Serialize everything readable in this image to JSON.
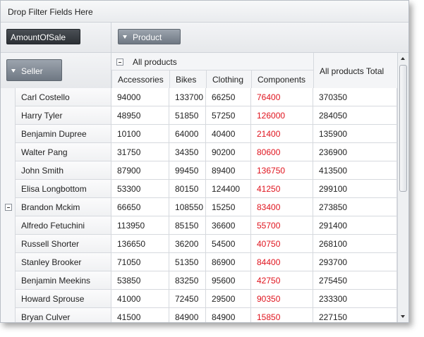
{
  "filter_bar": {
    "text": "Drop Filter Fields Here"
  },
  "data_fields": {
    "amount_chip": "AmountOfSale"
  },
  "column_fields": {
    "product_chip": "Product"
  },
  "row_fields": {
    "seller_chip": "Seller"
  },
  "column_header": {
    "group_label": "All products",
    "columns": [
      "Accessories",
      "Bikes",
      "Clothing",
      "Components"
    ],
    "total_label": "All products Total"
  },
  "rows": [
    {
      "seller": "Carl Costello",
      "accessories": "94000",
      "bikes": "133700",
      "clothing": "66250",
      "components": "76400",
      "total": "370350"
    },
    {
      "seller": "Harry Tyler",
      "accessories": "48950",
      "bikes": "51850",
      "clothing": "57250",
      "components": "126000",
      "total": "284050"
    },
    {
      "seller": "Benjamin Dupree",
      "accessories": "10100",
      "bikes": "64000",
      "clothing": "40400",
      "components": "21400",
      "total": "135900"
    },
    {
      "seller": "Walter Pang",
      "accessories": "31750",
      "bikes": "34350",
      "clothing": "90200",
      "components": "80600",
      "total": "236900"
    },
    {
      "seller": "John Smith",
      "accessories": "87900",
      "bikes": "99450",
      "clothing": "89400",
      "components": "136750",
      "total": "413500"
    },
    {
      "seller": "Elisa Longbottom",
      "accessories": "53300",
      "bikes": "80150",
      "clothing": "124400",
      "components": "41250",
      "total": "299100"
    },
    {
      "seller": "Brandon Mckim",
      "accessories": "66650",
      "bikes": "108550",
      "clothing": "15250",
      "components": "83400",
      "total": "273850"
    },
    {
      "seller": "Alfredo Fetuchini",
      "accessories": "113950",
      "bikes": "85150",
      "clothing": "36600",
      "components": "55700",
      "total": "291400"
    },
    {
      "seller": "Russell Shorter",
      "accessories": "136650",
      "bikes": "36200",
      "clothing": "54500",
      "components": "40750",
      "total": "268100"
    },
    {
      "seller": "Stanley Brooker",
      "accessories": "71050",
      "bikes": "51350",
      "clothing": "86900",
      "components": "84400",
      "total": "293700"
    },
    {
      "seller": "Benjamin Meekins",
      "accessories": "53850",
      "bikes": "83250",
      "clothing": "95600",
      "components": "42750",
      "total": "275450"
    },
    {
      "seller": "Howard Sprouse",
      "accessories": "41000",
      "bikes": "72450",
      "clothing": "29500",
      "components": "90350",
      "total": "233300"
    },
    {
      "seller": "Bryan Culver",
      "accessories": "41500",
      "bikes": "84900",
      "clothing": "84900",
      "components": "15850",
      "total": "227150"
    }
  ],
  "colors": {
    "components_text": "#e0141e",
    "chip_dark": "#2c3035",
    "chip_gray": "#6f7883"
  }
}
